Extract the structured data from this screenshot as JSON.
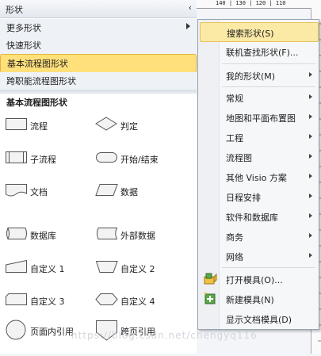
{
  "panel": {
    "title": "形状",
    "collapse_glyph": "‹",
    "stencil_rows": [
      {
        "label": "更多形状",
        "has_arrow": true
      },
      {
        "label": "快速形状",
        "has_arrow": false
      },
      {
        "label": "基本流程图形状",
        "has_arrow": false,
        "selected": true
      },
      {
        "label": "跨职能流程图形状",
        "has_arrow": false
      }
    ],
    "section_heading": "基本流程图形状",
    "shapes": [
      {
        "label": "流程",
        "icon": "process-shape-icon"
      },
      {
        "label": "判定",
        "icon": "decision-shape-icon"
      },
      {
        "label": "子流程",
        "icon": "subprocess-shape-icon"
      },
      {
        "label": "开始/结束",
        "icon": "start-end-shape-icon"
      },
      {
        "label": "文档",
        "icon": "document-shape-icon"
      },
      {
        "label": "数据",
        "icon": "data-shape-icon"
      },
      {
        "label": "数据库",
        "icon": "database-shape-icon"
      },
      {
        "label": "外部数据",
        "icon": "external-data-shape-icon"
      },
      {
        "label": "自定义 1",
        "icon": "custom1-shape-icon"
      },
      {
        "label": "自定义 2",
        "icon": "custom2-shape-icon"
      },
      {
        "label": "自定义 3",
        "icon": "custom3-shape-icon"
      },
      {
        "label": "自定义 4",
        "icon": "custom4-shape-icon"
      },
      {
        "label": "页面内引用",
        "icon": "on-page-reference-icon"
      },
      {
        "label": "跨页引用",
        "icon": "off-page-reference-icon"
      }
    ]
  },
  "ruler": {
    "labels": "140 | 130 | 120 | 110"
  },
  "menu": {
    "items": [
      {
        "label": "搜索形状(S)",
        "submenu": false,
        "highlighted": true
      },
      {
        "label": "联机查找形状(F)...",
        "submenu": false
      },
      {
        "label": "我的形状(M)",
        "submenu": true
      },
      {
        "label": "常规",
        "submenu": true
      },
      {
        "label": "地图和平面布置图",
        "submenu": true
      },
      {
        "label": "工程",
        "submenu": true
      },
      {
        "label": "流程图",
        "submenu": true
      },
      {
        "label": "其他 Visio 方案",
        "submenu": true
      },
      {
        "label": "日程安排",
        "submenu": true
      },
      {
        "label": "软件和数据库",
        "submenu": true
      },
      {
        "label": "商务",
        "submenu": true
      },
      {
        "label": "网络",
        "submenu": true
      },
      {
        "label": "打开模具(O)...",
        "submenu": false,
        "icon": "open-stencil-icon"
      },
      {
        "label": "新建模具(N)",
        "submenu": false,
        "icon": "new-stencil-icon"
      },
      {
        "label": "显示文档模具(D)",
        "submenu": false
      }
    ]
  },
  "watermark": "https://blog.csdn.net/chengyq116",
  "colors": {
    "selected_row": "#ffe07a",
    "menu_highlight": "#fbe9a6",
    "shape_fill": "#f3f3f3"
  }
}
